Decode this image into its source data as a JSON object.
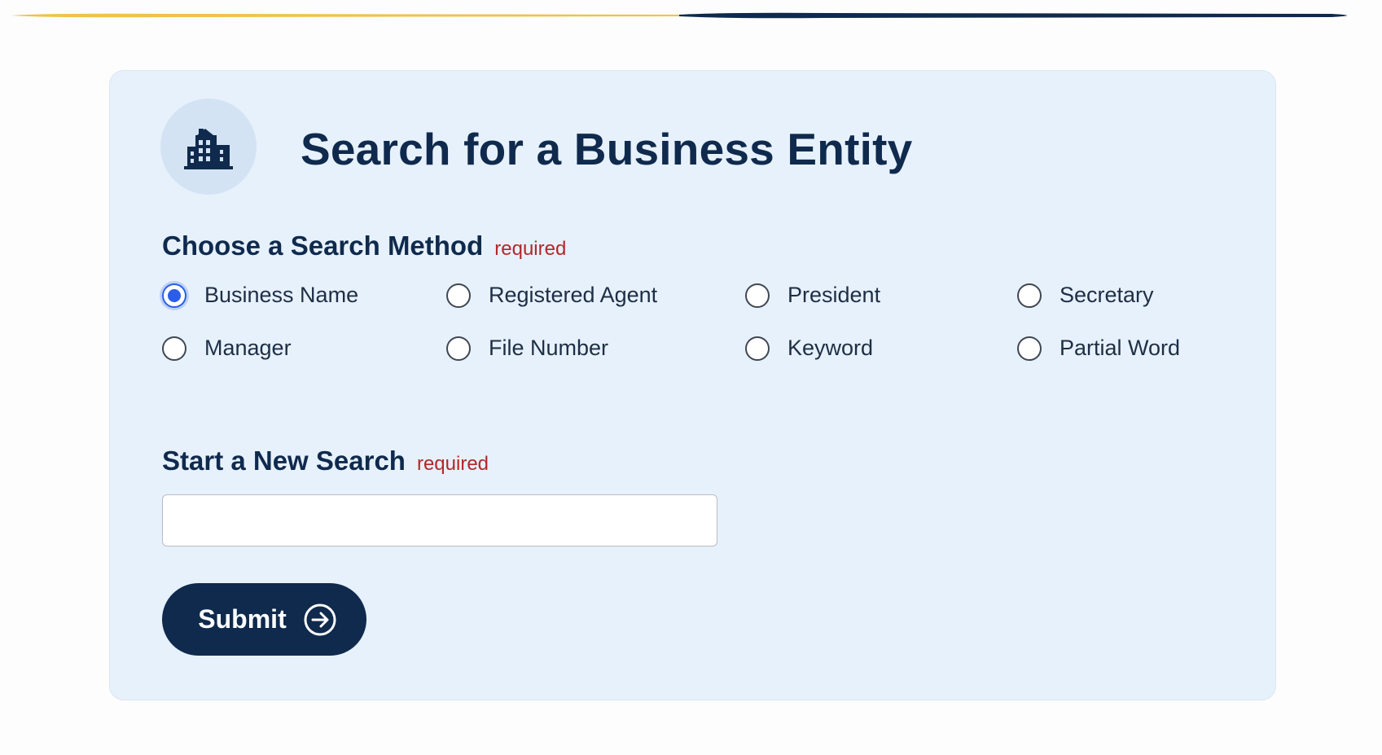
{
  "colors": {
    "accent_gold": "#f0c24b",
    "navy": "#0f2a4d",
    "card_background": "#e7f1fc",
    "required_red": "#b3262b",
    "radio_selected_blue": "#2a5ee8"
  },
  "header": {
    "icon": "building-icon",
    "title": "Search for a Business Entity"
  },
  "search_method": {
    "label": "Choose a Search Method",
    "required_text": "required",
    "selected": "Business Name",
    "options": [
      {
        "label": "Business Name",
        "selected": true
      },
      {
        "label": "Registered Agent",
        "selected": false
      },
      {
        "label": "President",
        "selected": false
      },
      {
        "label": "Secretary",
        "selected": false
      },
      {
        "label": "Manager",
        "selected": false
      },
      {
        "label": "File Number",
        "selected": false
      },
      {
        "label": "Keyword",
        "selected": false
      },
      {
        "label": "Partial Word",
        "selected": false
      }
    ]
  },
  "new_search": {
    "label": "Start a New Search",
    "required_text": "required",
    "value": "",
    "placeholder": ""
  },
  "submit": {
    "label": "Submit",
    "icon": "arrow-right-circle-icon"
  }
}
